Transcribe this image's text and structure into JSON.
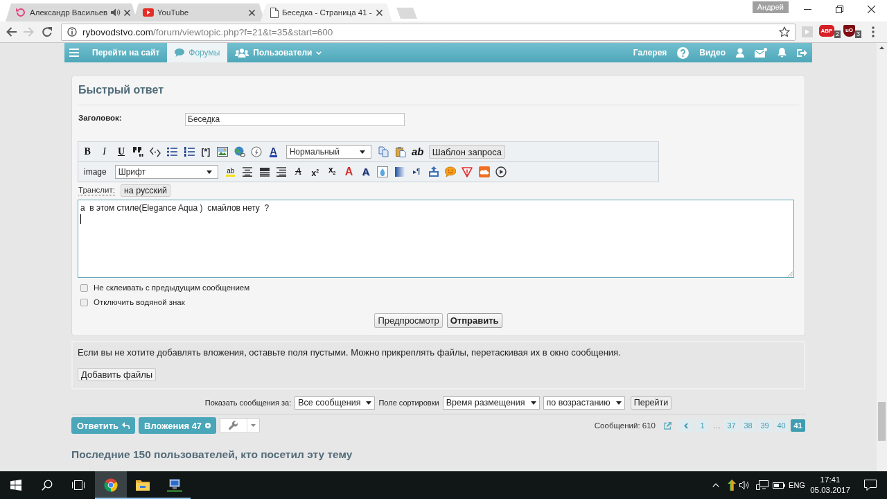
{
  "browser": {
    "tabs": [
      {
        "title": "Александр Васильев",
        "kind": "reload",
        "audio": true,
        "selected": false
      },
      {
        "title": "YouTube",
        "kind": "video",
        "audio": false,
        "selected": false
      },
      {
        "title": "Беседка - Страница 41 -",
        "kind": "page",
        "audio": false,
        "selected": true
      }
    ],
    "profile": "Андрей",
    "url": {
      "host": "rybovodstvo.com",
      "path": "/forum/viewtopic.php?f=21&t=35&start=600"
    },
    "extensions": [
      {
        "kind": "puzzle"
      },
      {
        "kind": "abp",
        "label": "ABP",
        "badge": "2"
      },
      {
        "kind": "shield",
        "label": "uO",
        "badge": "3"
      }
    ]
  },
  "nav": {
    "left": [
      {
        "kind": "menu",
        "selected": false,
        "dropdown": false
      },
      {
        "kind": "plain",
        "label": "Перейти на сайт",
        "selected": false,
        "dropdown": false
      },
      {
        "kind": "chat",
        "label": "Форумы",
        "selected": true,
        "dropdown": false
      },
      {
        "kind": "users",
        "label": "Пользователи",
        "selected": false,
        "dropdown": true
      }
    ],
    "right": [
      {
        "kind": "text",
        "label": "Галерея"
      },
      {
        "kind": "help"
      },
      {
        "kind": "text",
        "label": "Видео"
      },
      {
        "kind": "user"
      },
      {
        "kind": "mail"
      },
      {
        "kind": "bell"
      },
      {
        "kind": "logout"
      }
    ]
  },
  "quick_reply": {
    "title": "Быстрый ответ",
    "subject": {
      "label": "Заголовок:",
      "value": "Беседка"
    },
    "toolbar": [
      [
        {
          "kind": "bold",
          "label": "B"
        },
        {
          "kind": "italic",
          "label": "I"
        },
        {
          "kind": "underline",
          "label": "U"
        },
        {
          "kind": "quote"
        },
        {
          "kind": "code"
        },
        {
          "kind": "bullets"
        },
        {
          "kind": "numbers"
        },
        {
          "kind": "listitem",
          "label": "[*]"
        },
        {
          "kind": "image"
        },
        {
          "kind": "link"
        },
        {
          "kind": "flash"
        },
        {
          "kind": "fontcolor",
          "label": "A"
        },
        {
          "kind": "select",
          "value": "Нормальный"
        },
        {
          "kind": "copy"
        },
        {
          "kind": "paste"
        },
        {
          "kind": "spell",
          "label": "ab"
        },
        {
          "kind": "button",
          "label": "Шаблон запроса"
        }
      ],
      [
        {
          "kind": "text",
          "label": "image"
        },
        {
          "kind": "select",
          "value": "Шрифт"
        },
        {
          "kind": "highlight",
          "label": "ab"
        },
        {
          "kind": "center"
        },
        {
          "kind": "justify"
        },
        {
          "kind": "right"
        },
        {
          "kind": "strike",
          "label": "A"
        },
        {
          "kind": "sup",
          "label": "x$^{2}$"
        },
        {
          "kind": "sub",
          "label": "x$_{2}$"
        },
        {
          "kind": "outline",
          "label": "A"
        },
        {
          "kind": "shadow",
          "label": "A"
        },
        {
          "kind": "drop"
        },
        {
          "kind": "gradient"
        },
        {
          "kind": "direction",
          "label": "▸¶"
        },
        {
          "kind": "upload"
        },
        {
          "kind": "smile"
        },
        {
          "kind": "warning"
        },
        {
          "kind": "cloud"
        },
        {
          "kind": "play"
        }
      ]
    ],
    "translit": {
      "label": "Транслит:",
      "button": "на русский"
    },
    "message": "а  в этом стиле(Elegance Aqua )  смайлов нету  ?",
    "options": [
      {
        "label": "Не склеивать с предыдущим сообщением",
        "checked": false
      },
      {
        "label": "Отключить водяной знак",
        "checked": false
      }
    ],
    "buttons": [
      {
        "label": "Предпросмотр",
        "primary": false
      },
      {
        "label": "Отправить",
        "primary": true
      }
    ]
  },
  "attachments": {
    "note": "Если вы не хотите добавлять вложения, оставьте поля пустыми. Можно прикреплять файлы, перетаскивая их в окно сообщения.",
    "button": "Добавить файлы"
  },
  "sorting": {
    "show_label": "Показать сообщения за:",
    "show_value": "Все сообщения",
    "sort_label": "Поле сортировки",
    "sort_value": "Время размещения",
    "order_value": "по возрастанию",
    "go": "Перейти"
  },
  "actions": {
    "buttons": [
      {
        "kind": "reply",
        "label": "Ответить"
      },
      {
        "kind": "attachments",
        "label": "Вложения 47"
      },
      {
        "kind": "tools"
      }
    ],
    "count": "Сообщений: 610",
    "pages": [
      {
        "kind": "prev",
        "selected": false
      },
      {
        "kind": "page",
        "label": "1",
        "selected": false
      },
      {
        "kind": "gap",
        "label": "…",
        "selected": false
      },
      {
        "kind": "page",
        "label": "37",
        "selected": false
      },
      {
        "kind": "page",
        "label": "38",
        "selected": false
      },
      {
        "kind": "page",
        "label": "39",
        "selected": false
      },
      {
        "kind": "page",
        "label": "40",
        "selected": false
      },
      {
        "kind": "page",
        "label": "41",
        "selected": true
      }
    ]
  },
  "visitors": {
    "title": "Последние 150 пользователей, кто посетил эту тему"
  },
  "taskbar": {
    "apps": [
      {
        "kind": "browser",
        "active": true,
        "running": true
      },
      {
        "kind": "folder",
        "active": false,
        "running": true
      },
      {
        "kind": "computer",
        "active": false,
        "running": true
      }
    ],
    "lang": "ENG",
    "time": "17:41",
    "date": "05.03.2017"
  }
}
